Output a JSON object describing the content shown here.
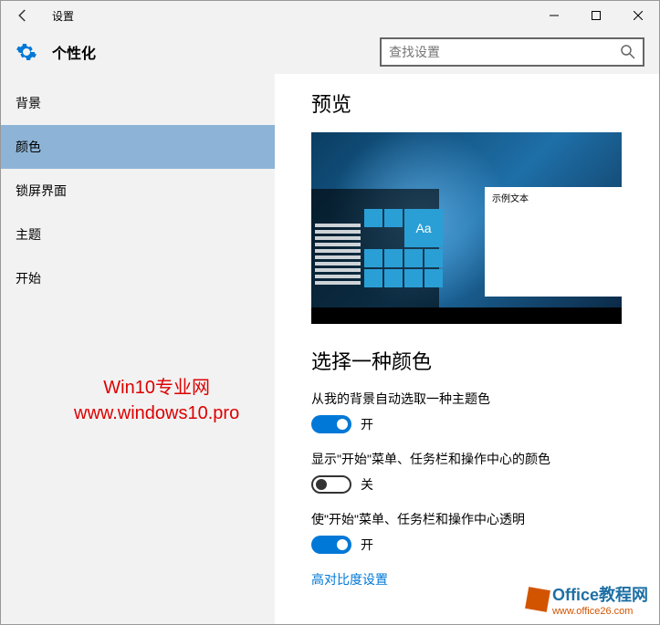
{
  "window": {
    "title": "设置"
  },
  "header": {
    "page_title": "个性化",
    "search_placeholder": "查找设置"
  },
  "sidebar": {
    "items": [
      {
        "label": "背景"
      },
      {
        "label": "颜色"
      },
      {
        "label": "锁屏界面"
      },
      {
        "label": "主题"
      },
      {
        "label": "开始"
      }
    ],
    "active_index": 1
  },
  "main": {
    "preview_heading": "预览",
    "preview_sample_text": "示例文本",
    "preview_tile_label": "Aa",
    "color_heading": "选择一种颜色",
    "settings": [
      {
        "label": "从我的背景自动选取一种主题色",
        "on": true,
        "state": "开"
      },
      {
        "label": "显示\"开始\"菜单、任务栏和操作中心的颜色",
        "on": false,
        "state": "关"
      },
      {
        "label": "使\"开始\"菜单、任务栏和操作中心透明",
        "on": true,
        "state": "开"
      }
    ],
    "high_contrast_link": "高对比度设置"
  },
  "watermarks": {
    "w1_line1": "Win10专业网",
    "w1_line2": "www.windows10.pro",
    "w2_brand": "Office教程网",
    "w2_url": "www.office26.com"
  },
  "colors": {
    "accent": "#0078d7"
  }
}
